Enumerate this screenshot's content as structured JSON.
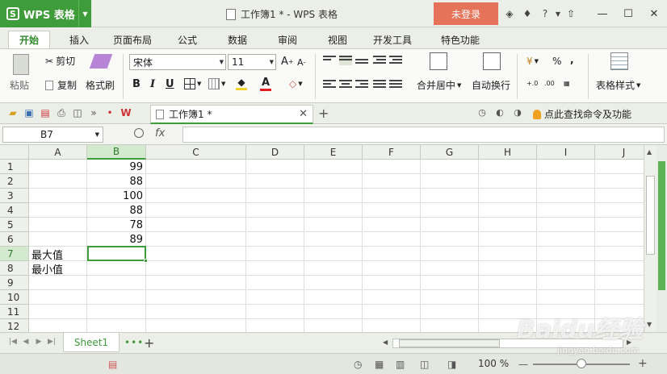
{
  "app": {
    "name": "WPS 表格",
    "logo_letter": "S",
    "doc_title": "工作簿1 * - WPS 表格",
    "login_label": "未登录"
  },
  "ribbon_tabs": [
    "开始",
    "插入",
    "页面布局",
    "公式",
    "数据",
    "审阅",
    "视图",
    "开发工具",
    "特色功能"
  ],
  "ribbon": {
    "paste": "粘贴",
    "cut": "剪切",
    "copy": "复制",
    "format_painter": "格式刷",
    "font_name": "宋体",
    "font_size": "11",
    "bold": "B",
    "italic": "I",
    "underline": "U",
    "merge_center": "合并居中",
    "wrap_text": "自动换行",
    "percent": "%",
    "table_style": "表格样式"
  },
  "doc_tab": {
    "label": "工作簿1 *",
    "find_command": "点此查找命令及功能"
  },
  "formula_bar": {
    "name_box": "B7",
    "fx": "fx",
    "value": ""
  },
  "grid": {
    "columns": [
      "A",
      "B",
      "C",
      "D",
      "E",
      "F",
      "G",
      "H",
      "I",
      "J"
    ],
    "rows": [
      "1",
      "2",
      "3",
      "4",
      "5",
      "6",
      "7",
      "8",
      "9",
      "10",
      "11",
      "12"
    ],
    "selected_column": "B",
    "selected_row": "7",
    "colB_values": [
      "99",
      "88",
      "100",
      "88",
      "78",
      "89"
    ],
    "colA_labels": [
      "最大值",
      "最小值"
    ]
  },
  "sheets": [
    "Sheet1"
  ],
  "status": {
    "zoom": "100 %"
  },
  "watermark": {
    "brand": "Baidu经验",
    "url": "jingyan.baidu.com"
  },
  "colors": {
    "accent": "#3f9c3a",
    "login": "#e4735a"
  }
}
